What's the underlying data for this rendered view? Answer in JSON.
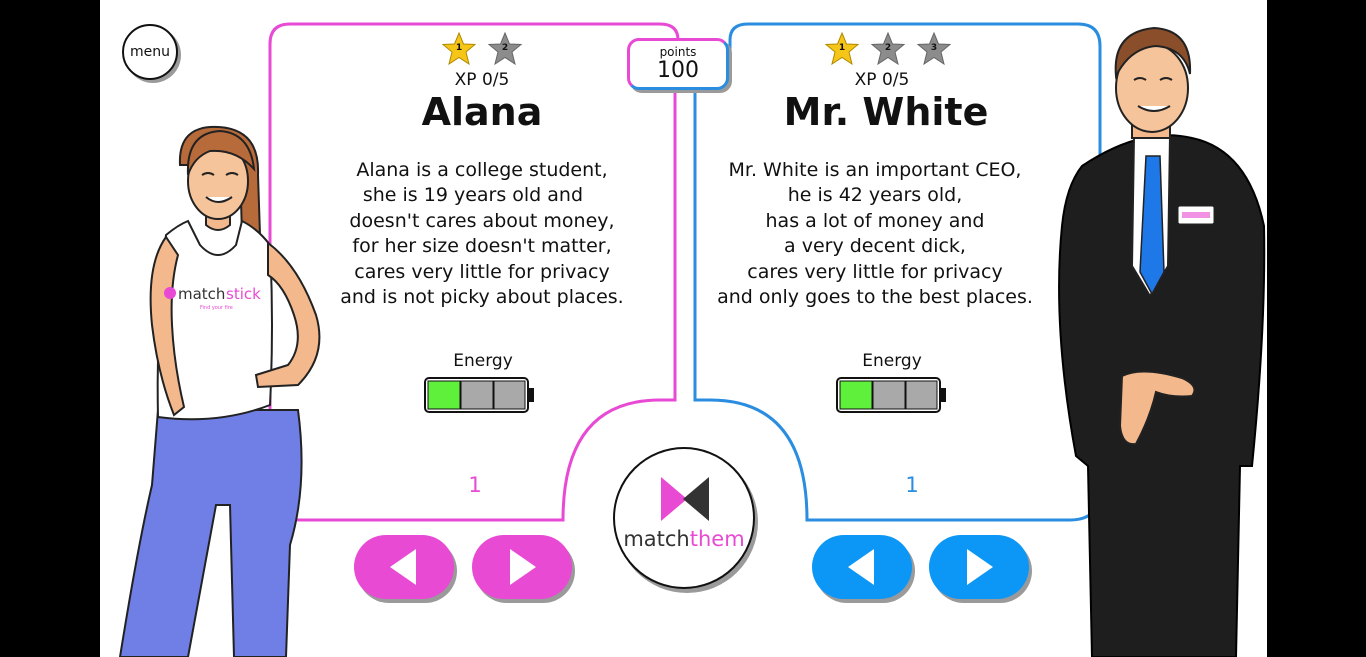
{
  "menu": {
    "label": "menu"
  },
  "points": {
    "label": "points",
    "value": "100"
  },
  "left_card": {
    "stars": [
      "1",
      "2"
    ],
    "xp": "XP 0/5",
    "name": "Alana",
    "description": [
      "Alana is a college student,",
      "she is 19 years old and   ",
      "doesn't cares about money,",
      "for her size doesn't matter,",
      "cares very little for privacy",
      "and is not picky about places."
    ],
    "energy_label": "Energy",
    "energy_level": "1 of 3",
    "counter": "1",
    "accent": "#e84ad4"
  },
  "right_card": {
    "stars": [
      "1",
      "2",
      "3"
    ],
    "xp": "XP 0/5",
    "name": "Mr. White",
    "description": [
      "Mr. White is an important CEO,",
      "he is 42 years old,",
      "has a lot of money and",
      "a very decent dick,",
      "cares very little for privacy",
      "and only goes to the best places."
    ],
    "energy_label": "Energy",
    "energy_level": "1 of 3",
    "counter": "1",
    "accent": "#2a8de0"
  },
  "logo": {
    "part1": "match",
    "part2": "them"
  },
  "shirt_logo": {
    "part1": "match",
    "part2": "stick",
    "tagline": "Find your fire"
  },
  "colors": {
    "pink": "#e84ad4",
    "blue": "#2a8de0",
    "button_blue": "#0c96f5",
    "energy_green": "#5ef03a",
    "energy_gray": "#a9a9a9",
    "star_gold": "#f5c518",
    "star_gray": "#8c8c8c"
  },
  "icons": {
    "prev": "triangle-left-icon",
    "next": "triangle-right-icon",
    "star": "star-icon"
  }
}
